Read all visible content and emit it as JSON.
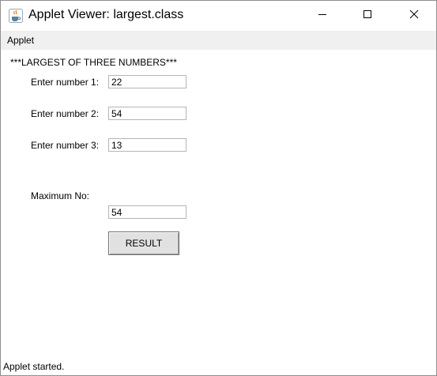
{
  "window": {
    "title": "Applet Viewer: largest.class",
    "app_icon": "java-cup-icon",
    "controls": [
      "minimize-icon",
      "maximize-icon",
      "close-icon"
    ]
  },
  "menu": {
    "items": [
      "Applet"
    ]
  },
  "applet": {
    "heading": "***LARGEST OF THREE NUMBERS***",
    "fields": [
      {
        "label": "Enter number 1:",
        "value": "22"
      },
      {
        "label": "Enter number 2:",
        "value": "54"
      },
      {
        "label": "Enter number 3:",
        "value": "13"
      }
    ],
    "max_label": "Maximum No:",
    "max_value": "54",
    "button_label": "RESULT"
  },
  "status": {
    "text": "Applet started."
  },
  "colors": {
    "menubar_bg": "#f0f0f0",
    "button_bg": "#e1e1e1",
    "field_border": "#b5b5b5"
  }
}
